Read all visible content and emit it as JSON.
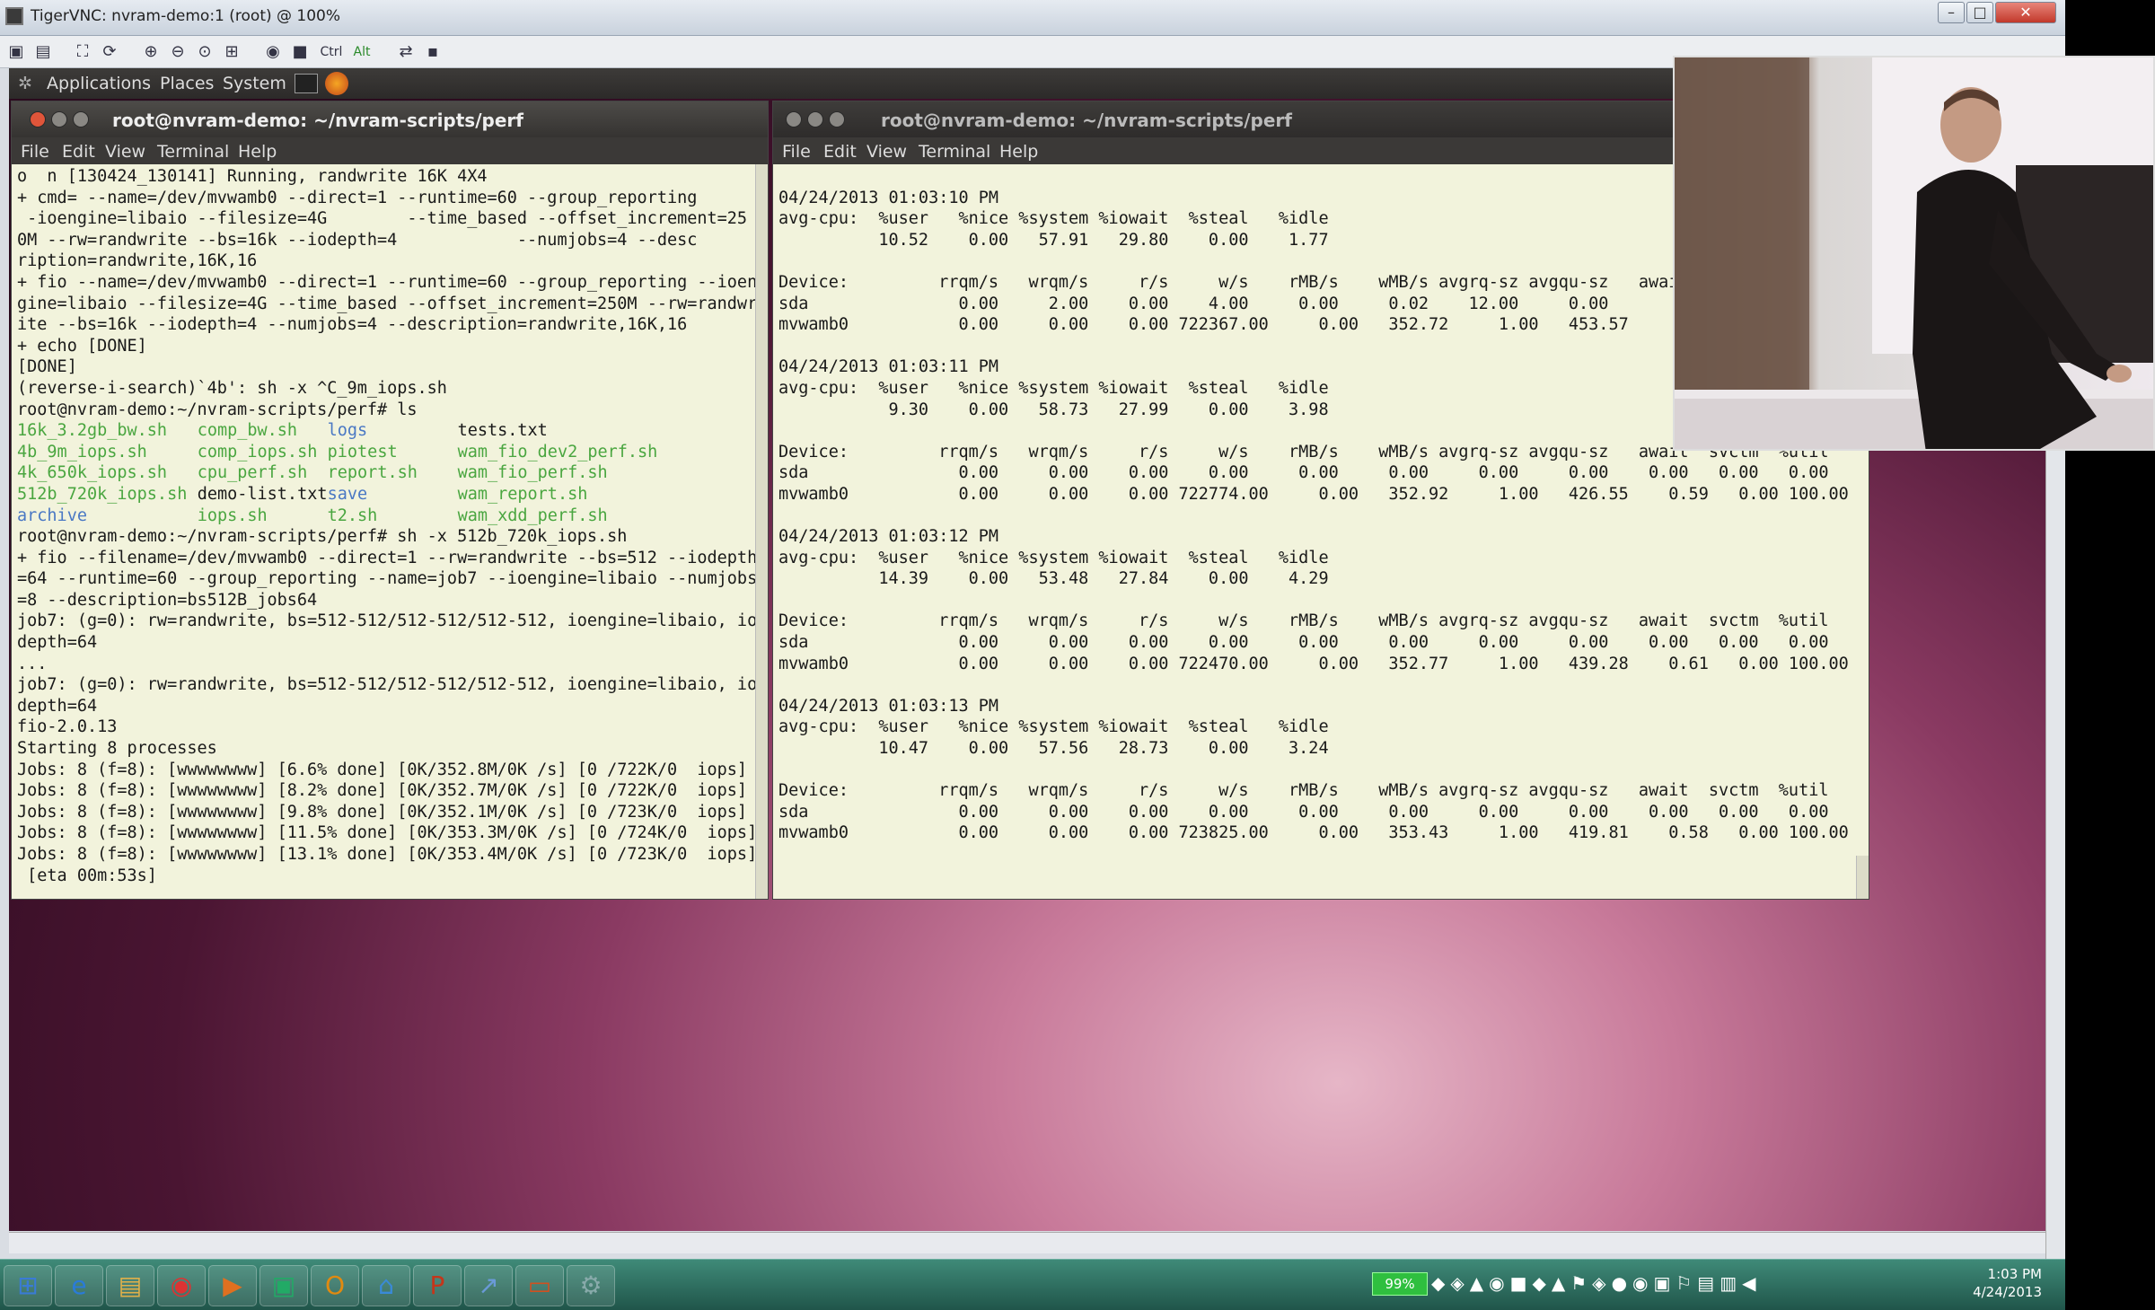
{
  "vnc": {
    "title": "TigerVNC: nvram-demo:1 (root) @ 100%"
  },
  "vnc_toolbar": {
    "ctrl_label": "Ctrl",
    "alt_label": "Alt"
  },
  "gnome_panel": {
    "applications": "Applications",
    "places": "Places",
    "system": "System"
  },
  "menu": {
    "file": "File",
    "edit": "Edit",
    "view": "View",
    "terminal": "Terminal",
    "help": "Help"
  },
  "left_terminal": {
    "title": "root@nvram-demo: ~/nvram-scripts/perf",
    "lines": [
      "o  n [130424_130141] Running, randwrite 16K 4X4",
      "+ cmd= --name=/dev/mvwamb0 --direct=1 --runtime=60 --group_reporting",
      " -ioengine=libaio --filesize=4G        --time_based --offset_increment=25",
      "0M --rw=randwrite --bs=16k --iodepth=4            --numjobs=4 --desc",
      "ription=randwrite,16K,16",
      "+ fio --name=/dev/mvwamb0 --direct=1 --runtime=60 --group_reporting --ioen",
      "gine=libaio --filesize=4G --time_based --offset_increment=250M --rw=randwr",
      "ite --bs=16k --iodepth=4 --numjobs=4 --description=randwrite,16K,16",
      "+ echo [DONE]",
      "[DONE]",
      "(reverse-i-search)`4b': sh -x ^C_9m_iops.sh",
      "root@nvram-demo:~/nvram-scripts/perf# ls"
    ],
    "ls_rows": [
      [
        "16k_3.2gb_bw.sh",
        "comp_bw.sh",
        "logs",
        "tests.txt"
      ],
      [
        "4b_9m_iops.sh",
        "comp_iops.sh",
        "piotest",
        "wam_fio_dev2_perf.sh"
      ],
      [
        "4k_650k_iops.sh",
        "cpu_perf.sh",
        "report.sh",
        "wam_fio_perf.sh"
      ],
      [
        "512b_720k_iops.sh",
        "demo-list.txt",
        "save",
        "wam_report.sh"
      ],
      [
        "archive",
        "iops.sh",
        "t2.sh",
        "wam_xdd_perf.sh"
      ]
    ],
    "lines2": [
      "root@nvram-demo:~/nvram-scripts/perf# sh -x 512b_720k_iops.sh",
      "+ fio --filename=/dev/mvwamb0 --direct=1 --rw=randwrite --bs=512 --iodepth",
      "=64 --runtime=60 --group_reporting --name=job7 --ioengine=libaio --numjobs",
      "=8 --description=bs512B_jobs64",
      "job7: (g=0): rw=randwrite, bs=512-512/512-512/512-512, ioengine=libaio, io",
      "depth=64",
      "...",
      "job7: (g=0): rw=randwrite, bs=512-512/512-512/512-512, ioengine=libaio, io",
      "depth=64",
      "fio-2.0.13",
      "Starting 8 processes",
      "Jobs: 8 (f=8): [wwwwwwww] [6.6% done] [0K/352.8M/0K /s] [0 /722K/0  iops]",
      "Jobs: 8 (f=8): [wwwwwwww] [8.2% done] [0K/352.7M/0K /s] [0 /722K/0  iops]",
      "Jobs: 8 (f=8): [wwwwwwww] [9.8% done] [0K/352.1M/0K /s] [0 /723K/0  iops]",
      "Jobs: 8 (f=8): [wwwwwwww] [11.5% done] [0K/353.3M/0K /s] [0 /724K/0  iops]",
      "Jobs: 8 (f=8): [wwwwwwww] [13.1% done] [0K/353.4M/0K /s] [0 /723K/0  iops]",
      " [eta 00m:53s]"
    ]
  },
  "right_terminal": {
    "title": "root@nvram-demo: ~/nvram-scripts/perf",
    "lines": [
      "",
      "04/24/2013 01:03:10 PM",
      "avg-cpu:  %user   %nice %system %iowait  %steal   %idle",
      "          10.52    0.00   57.91   29.80    0.00    1.77",
      "",
      "Device:         rrqm/s   wrqm/s     r/s     w/s    rMB/s    wMB/s avgrq-sz avgqu-sz   await",
      "sda               0.00     2.00    0.00    4.00     0.00     0.02    12.00     0.00",
      "mvwamb0           0.00     0.00    0.00 722367.00     0.00   352.72     1.00   453.57     0.",
      "",
      "04/24/2013 01:03:11 PM",
      "avg-cpu:  %user   %nice %system %iowait  %steal   %idle",
      "           9.30    0.00   58.73   27.99    0.00    3.98",
      "",
      "Device:         rrqm/s   wrqm/s     r/s     w/s    rMB/s    wMB/s avgrq-sz avgqu-sz   await  svctm  %util",
      "sda               0.00     0.00    0.00    0.00     0.00     0.00     0.00     0.00    0.00   0.00   0.00",
      "mvwamb0           0.00     0.00    0.00 722774.00     0.00   352.92     1.00   426.55    0.59   0.00 100.00",
      "",
      "04/24/2013 01:03:12 PM",
      "avg-cpu:  %user   %nice %system %iowait  %steal   %idle",
      "          14.39    0.00   53.48   27.84    0.00    4.29",
      "",
      "Device:         rrqm/s   wrqm/s     r/s     w/s    rMB/s    wMB/s avgrq-sz avgqu-sz   await  svctm  %util",
      "sda               0.00     0.00    0.00    0.00     0.00     0.00     0.00     0.00    0.00   0.00   0.00",
      "mvwamb0           0.00     0.00    0.00 722470.00     0.00   352.77     1.00   439.28    0.61   0.00 100.00",
      "",
      "04/24/2013 01:03:13 PM",
      "avg-cpu:  %user   %nice %system %iowait  %steal   %idle",
      "          10.47    0.00   57.56   28.73    0.00    3.24",
      "",
      "Device:         rrqm/s   wrqm/s     r/s     w/s    rMB/s    wMB/s avgrq-sz avgqu-sz   await  svctm  %util",
      "sda               0.00     0.00    0.00    0.00     0.00     0.00     0.00     0.00    0.00   0.00   0.00",
      "mvwamb0           0.00     0.00    0.00 723825.00     0.00   353.43     1.00   419.81    0.58   0.00 100.00",
      ""
    ]
  },
  "taskbar": {
    "battery": "99%",
    "time": "1:03 PM",
    "date": "4/24/2013",
    "icons": [
      "start-orb-icon",
      "ie-icon",
      "folder-icon",
      "chrome-icon",
      "media-player-icon",
      "vnc-viewer-icon",
      "outlook-icon",
      "network-tool-icon",
      "powerpoint-icon",
      "remote-tool-icon",
      "terminal-app-icon",
      "settings-tool-icon"
    ]
  }
}
